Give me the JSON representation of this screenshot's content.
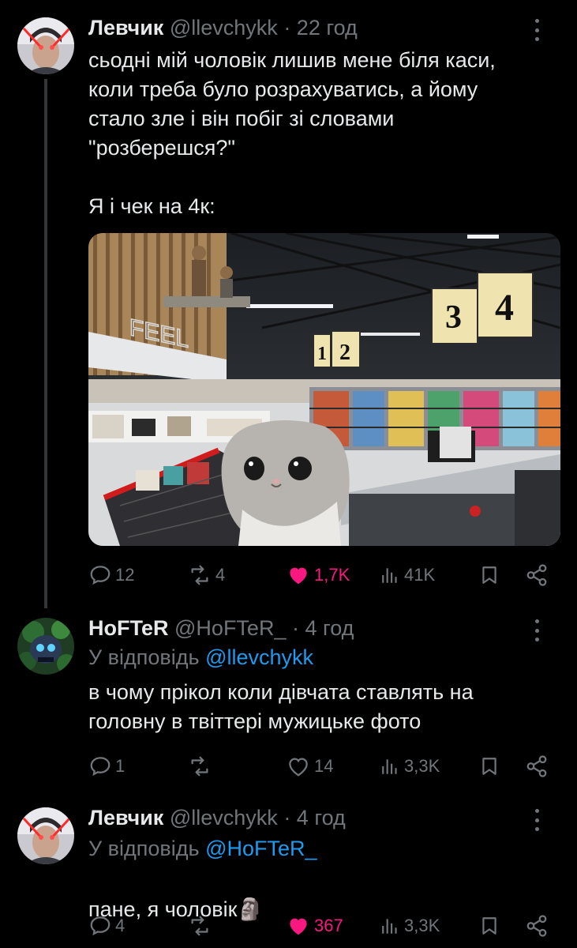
{
  "tweets": [
    {
      "name": "Левчик",
      "handle": "@llevchykk",
      "time": "· 22 год",
      "text": "сьодні мій чоловік лишив мене біля каси,\nколи треба було розрахуватись, а йому\nстало зле і він побіг зі словами\n\"розберешся?\"\n\nЯ і чек на 4к:",
      "media_icon": "supermarket-checkout-with-sad-hamster-meme",
      "stats": {
        "replies": "12",
        "reposts": "4",
        "likes": "1,7K",
        "views": "41K"
      },
      "liked": true
    },
    {
      "name": "HoFTeR",
      "handle": "@HoFTeR_",
      "time": "· 4 год",
      "reply_prefix": "У відповідь",
      "reply_to": "@llevchykk",
      "text": "в чому прікол коли дівчата ставлять на\nголовну в твіттері мужицьке фото",
      "stats": {
        "replies": "1",
        "reposts": "",
        "likes": "14",
        "views": "3,3K"
      },
      "liked": false
    },
    {
      "name": "Левчик",
      "handle": "@llevchykk",
      "time": "· 4 год",
      "reply_prefix": "У відповідь",
      "reply_to": "@HoFTeR_",
      "text": "пане, я чоловік",
      "emoji": "🗿",
      "stats": {
        "replies": "4",
        "reposts": "",
        "likes": "367",
        "views": "3,3K"
      },
      "liked": true
    }
  ],
  "store_signs": [
    "1",
    "2",
    "3",
    "4"
  ],
  "store_brand": "FEEL",
  "colors": {
    "background": "#000000",
    "text": "#e7e9ea",
    "muted": "#71767b",
    "link": "#1d9bf0",
    "like": "#f91880"
  }
}
